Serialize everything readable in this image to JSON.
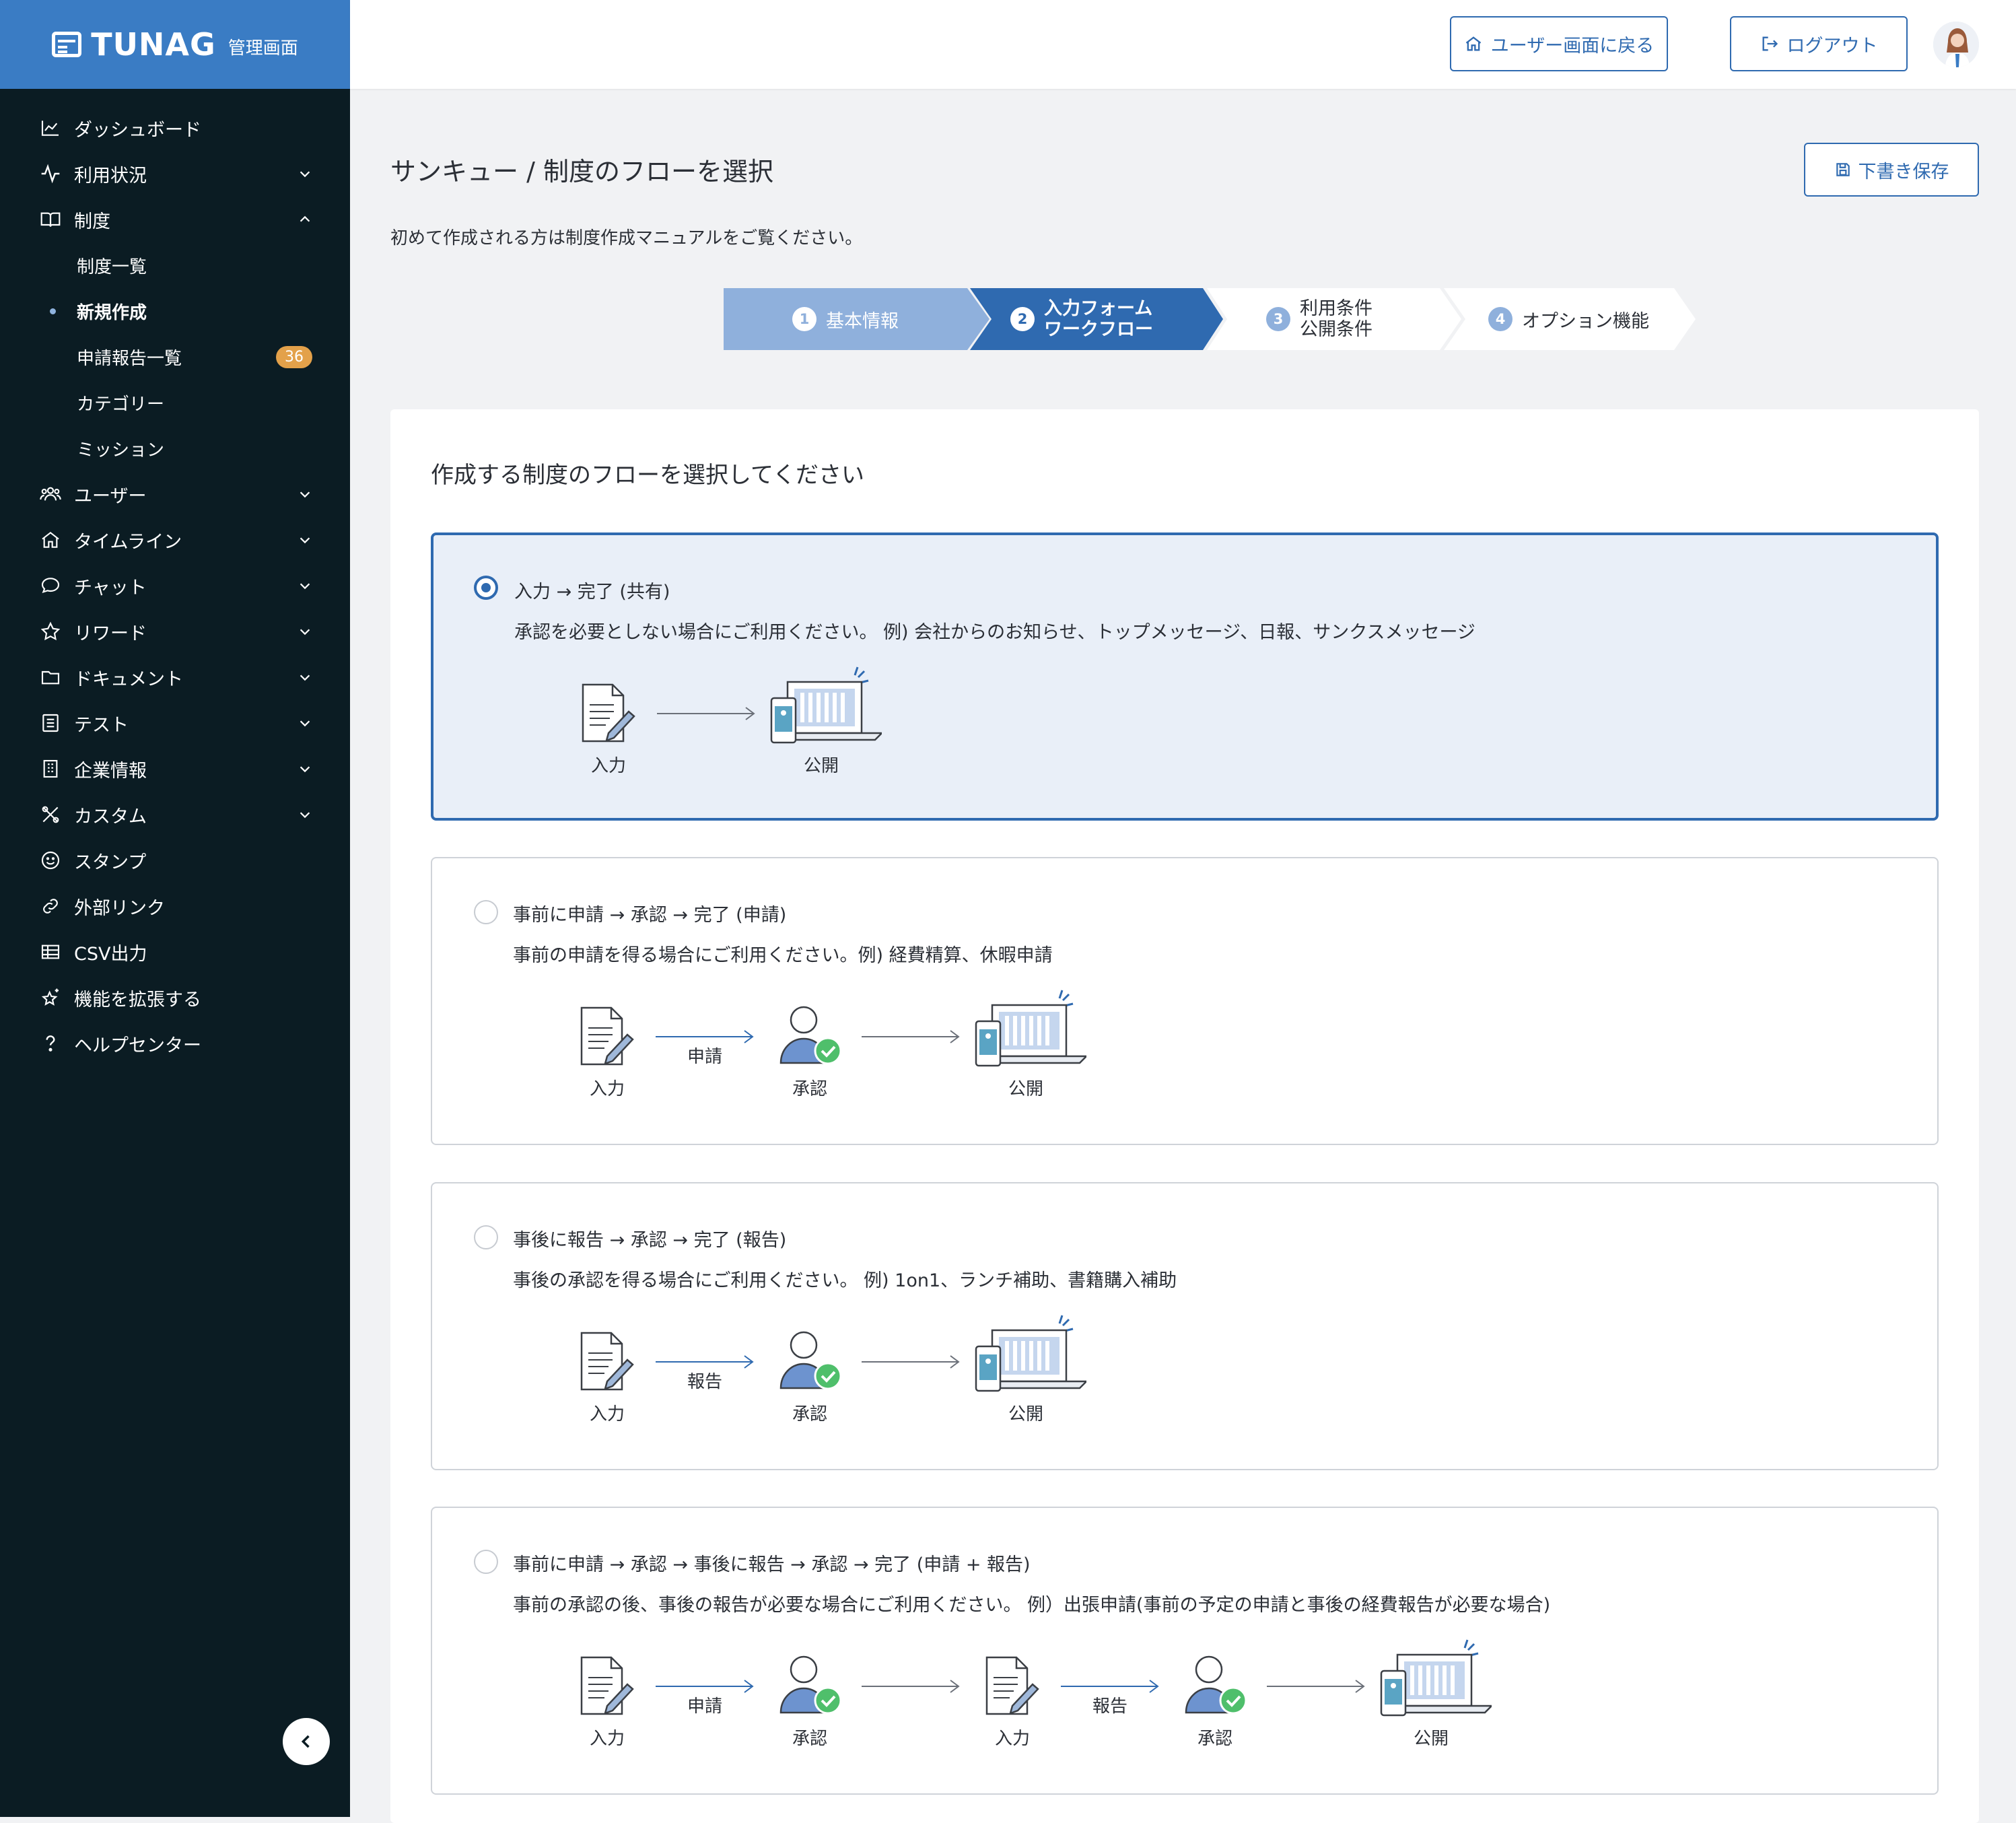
{
  "brand": {
    "name": "TUNAG",
    "sub": "管理画面"
  },
  "sidebar": {
    "items": [
      {
        "label": "ダッシュボード"
      },
      {
        "label": "利用状況"
      },
      {
        "label": "制度"
      },
      {
        "label": "ユーザー"
      },
      {
        "label": "タイムライン"
      },
      {
        "label": "チャット"
      },
      {
        "label": "リワード"
      },
      {
        "label": "ドキュメント"
      },
      {
        "label": "テスト"
      },
      {
        "label": "企業情報"
      },
      {
        "label": "カスタム"
      },
      {
        "label": "スタンプ"
      },
      {
        "label": "外部リンク"
      },
      {
        "label": "CSV出力"
      },
      {
        "label": "機能を拡張する"
      },
      {
        "label": "ヘルプセンター"
      }
    ],
    "sub": [
      {
        "label": "制度一覧"
      },
      {
        "label": "新規作成"
      },
      {
        "label": "申請報告一覧",
        "badge": "36"
      },
      {
        "label": "カテゴリー"
      },
      {
        "label": "ミッション"
      }
    ]
  },
  "header": {
    "back_label": "ユーザー画面に戻る",
    "logout_label": "ログアウト"
  },
  "page": {
    "title": "サンキュー / 制度のフローを選択",
    "draft_label": "下書き保存",
    "intro": "初めて作成される方は制度作成マニュアルをご覧ください。"
  },
  "steps": [
    {
      "num": "1",
      "label": "基本情報"
    },
    {
      "num": "2",
      "label": "入力フォーム",
      "label2": "ワークフロー"
    },
    {
      "num": "3",
      "label": "利用条件",
      "label2": "公開条件"
    },
    {
      "num": "4",
      "label": "オプション機能"
    }
  ],
  "card": {
    "title": "作成する制度のフローを選択してください"
  },
  "options": [
    {
      "title": "入力 → 完了 (共有)",
      "desc": "承認を必要としない場合にご利用ください。 例) 会社からのお知らせ、トップメッセージ、日報、サンクスメッセージ",
      "nodes": [
        "入力",
        "公開"
      ],
      "arrows": [
        ""
      ]
    },
    {
      "title": "事前に申請 → 承認 → 完了 (申請)",
      "desc": "事前の申請を得る場合にご利用ください。例) 経費精算、休暇申請",
      "nodes": [
        "入力",
        "承認",
        "公開"
      ],
      "arrows": [
        "申請",
        ""
      ]
    },
    {
      "title": "事後に報告 → 承認 → 完了 (報告)",
      "desc": "事後の承認を得る場合にご利用ください。 例) 1on1、ランチ補助、書籍購入補助",
      "nodes": [
        "入力",
        "承認",
        "公開"
      ],
      "arrows": [
        "報告",
        ""
      ]
    },
    {
      "title": "事前に申請 → 承認 → 事後に報告 → 承認 → 完了 (申請 + 報告)",
      "desc": "事前の承認の後、事後の報告が必要な場合にご利用ください。 例）出張申請(事前の予定の申請と事後の経費報告が必要な場合)",
      "nodes": [
        "入力",
        "承認",
        "入力",
        "承認",
        "公開"
      ],
      "arrows": [
        "申請",
        "",
        "報告",
        ""
      ]
    }
  ],
  "colors": {
    "primary": "#2f6ab0",
    "sidebar": "#0b1c23",
    "brand_bar": "#3a7cc4",
    "badge": "#e3a14a",
    "selected_bg": "#e9eff8",
    "step_done": "#8fb0dc"
  }
}
